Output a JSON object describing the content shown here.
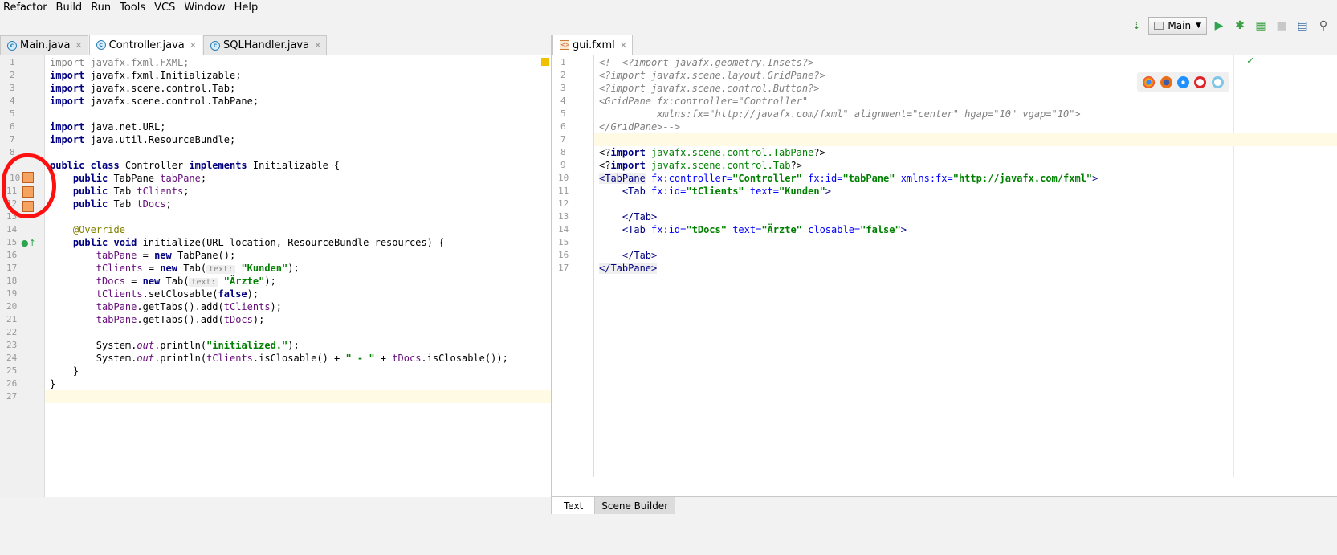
{
  "menu": [
    "Refactor",
    "Build",
    "Run",
    "Tools",
    "VCS",
    "Window",
    "Help"
  ],
  "run_config": "Main",
  "left_tabs": [
    {
      "label": "Main.java",
      "active": false
    },
    {
      "label": "Controller.java",
      "active": true
    },
    {
      "label": "SQLHandler.java",
      "active": false
    }
  ],
  "right_tabs": [
    {
      "label": "gui.fxml",
      "active": true
    }
  ],
  "bottom_tabs": {
    "text": "Text",
    "scene_builder": "Scene Builder"
  },
  "java_lines": [
    {
      "n": "1"
    },
    {
      "n": "2"
    },
    {
      "n": "3"
    },
    {
      "n": "4"
    },
    {
      "n": "5"
    },
    {
      "n": "6"
    },
    {
      "n": "7"
    },
    {
      "n": "8"
    },
    {
      "n": "10"
    },
    {
      "n": "11"
    },
    {
      "n": "12"
    },
    {
      "n": "13"
    },
    {
      "n": "14"
    },
    {
      "n": "15"
    },
    {
      "n": "16"
    },
    {
      "n": "17"
    },
    {
      "n": "18"
    },
    {
      "n": "19"
    },
    {
      "n": "20"
    },
    {
      "n": "21"
    },
    {
      "n": "22"
    },
    {
      "n": "23"
    },
    {
      "n": "24"
    },
    {
      "n": "25"
    },
    {
      "n": "26"
    },
    {
      "n": "27"
    }
  ],
  "java": {
    "l1_kw": "import",
    "l1": " javafx.fxml.FXML;",
    "l2_kw": "import",
    "l2": " javafx.fxml.Initializable;",
    "l3_kw": "import",
    "l3": " javafx.scene.control.Tab;",
    "l4_kw": "import",
    "l4": " javafx.scene.control.TabPane;",
    "l6_kw": "import",
    "l6": " java.net.URL;",
    "l7_kw": "import",
    "l7": " java.util.ResourceBundle;",
    "l9_kw1": "public class",
    "l9_a": " Controller ",
    "l9_kw2": "implements",
    "l9_b": " Initializable {",
    "l10_kw": "public",
    "l10_a": " TabPane ",
    "l10_f": "tabPane",
    "l10_b": ";",
    "l11_kw": "public",
    "l11_a": " Tab ",
    "l11_f": "tClients",
    "l11_b": ";",
    "l12_kw": "public",
    "l12_a": " Tab ",
    "l12_f": "tDocs",
    "l12_b": ";",
    "l14": "@Override",
    "l15_kw": "public void",
    "l15": " initialize(URL location, ResourceBundle resources) {",
    "l16_f": "tabPane",
    "l16_a": " = ",
    "l16_kw": "new",
    "l16_b": " TabPane();",
    "l17_f": "tClients",
    "l17_a": " = ",
    "l17_kw": "new",
    "l17_b": " Tab(",
    "l17_hint": "text:",
    "l17_s": "\"Kunden\"",
    "l17_c": ");",
    "l18_f": "tDocs",
    "l18_a": " = ",
    "l18_kw": "new",
    "l18_b": " Tab(",
    "l18_hint": "text:",
    "l18_s": "\"Ärzte\"",
    "l18_c": ");",
    "l19_f": "tClients",
    "l19_a": ".setClosable(",
    "l19_kw": "false",
    "l19_b": ");",
    "l20_f": "tabPane",
    "l20_a": ".getTabs().add(",
    "l20_f2": "tClients",
    "l20_b": ");",
    "l21_f": "tabPane",
    "l21_a": ".getTabs().add(",
    "l21_f2": "tDocs",
    "l21_b": ");",
    "l23_a": "System.",
    "l23_f": "out",
    "l23_b": ".println(",
    "l23_s": "\"initialized.\"",
    "l23_c": ");",
    "l24_a": "System.",
    "l24_f": "out",
    "l24_b": ".println(",
    "l24_f2": "tClients",
    "l24_c": ".isClosable() + ",
    "l24_s": "\" - \"",
    "l24_d": " + ",
    "l24_f3": "tDocs",
    "l24_e": ".isClosable());",
    "l25": "}",
    "l26": "}"
  },
  "fxml": {
    "l1": "<!--<?import javafx.geometry.Insets?>",
    "l2": "<?import javafx.scene.layout.GridPane?>",
    "l3": "<?import javafx.scene.control.Button?>",
    "l4": "<GridPane fx:controller=\"Controller\"",
    "l5": "          xmlns:fx=\"http://javafx.com/fxml\" alignment=\"center\" hgap=\"10\" vgap=\"10\">",
    "l6": "</GridPane>-->",
    "l8_a": "<?",
    "l8_kw": "import",
    "l8_v": " javafx.scene.control.TabPane",
    "l8_b": "?>",
    "l9_a": "<?",
    "l9_kw": "import",
    "l9_v": " javafx.scene.control.Tab",
    "l9_b": "?>",
    "l10_t": "<TabPane",
    "l10_a1": " fx:controller=",
    "l10_v1": "\"Controller\"",
    "l10_a2": " fx:id=",
    "l10_v2": "\"tabPane\"",
    "l10_a3": " xmlns:fx=",
    "l10_v3": "\"http://javafx.com/fxml\"",
    "l10_e": ">",
    "l11_t": "<Tab",
    "l11_a1": " fx:id=",
    "l11_v1": "\"tClients\"",
    "l11_a2": " text=",
    "l11_v2": "\"Kunden\"",
    "l11_e": ">",
    "l13": "</Tab>",
    "l14_t": "<Tab",
    "l14_a1": " fx:id=",
    "l14_v1": "\"tDocs\"",
    "l14_a2": " text=",
    "l14_v2": "\"Ärzte\"",
    "l14_a3": " closable=",
    "l14_v3": "\"false\"",
    "l14_e": ">",
    "l16": "</Tab>",
    "l17": "</TabPane>"
  },
  "fxml_line_numbers": [
    "1",
    "2",
    "3",
    "4",
    "5",
    "6",
    "7",
    "8",
    "9",
    "10",
    "11",
    "12",
    "13",
    "14",
    "15",
    "16",
    "17"
  ],
  "colors": {
    "annotation_circle": "#ff1010",
    "current_line": "#fffae3"
  }
}
